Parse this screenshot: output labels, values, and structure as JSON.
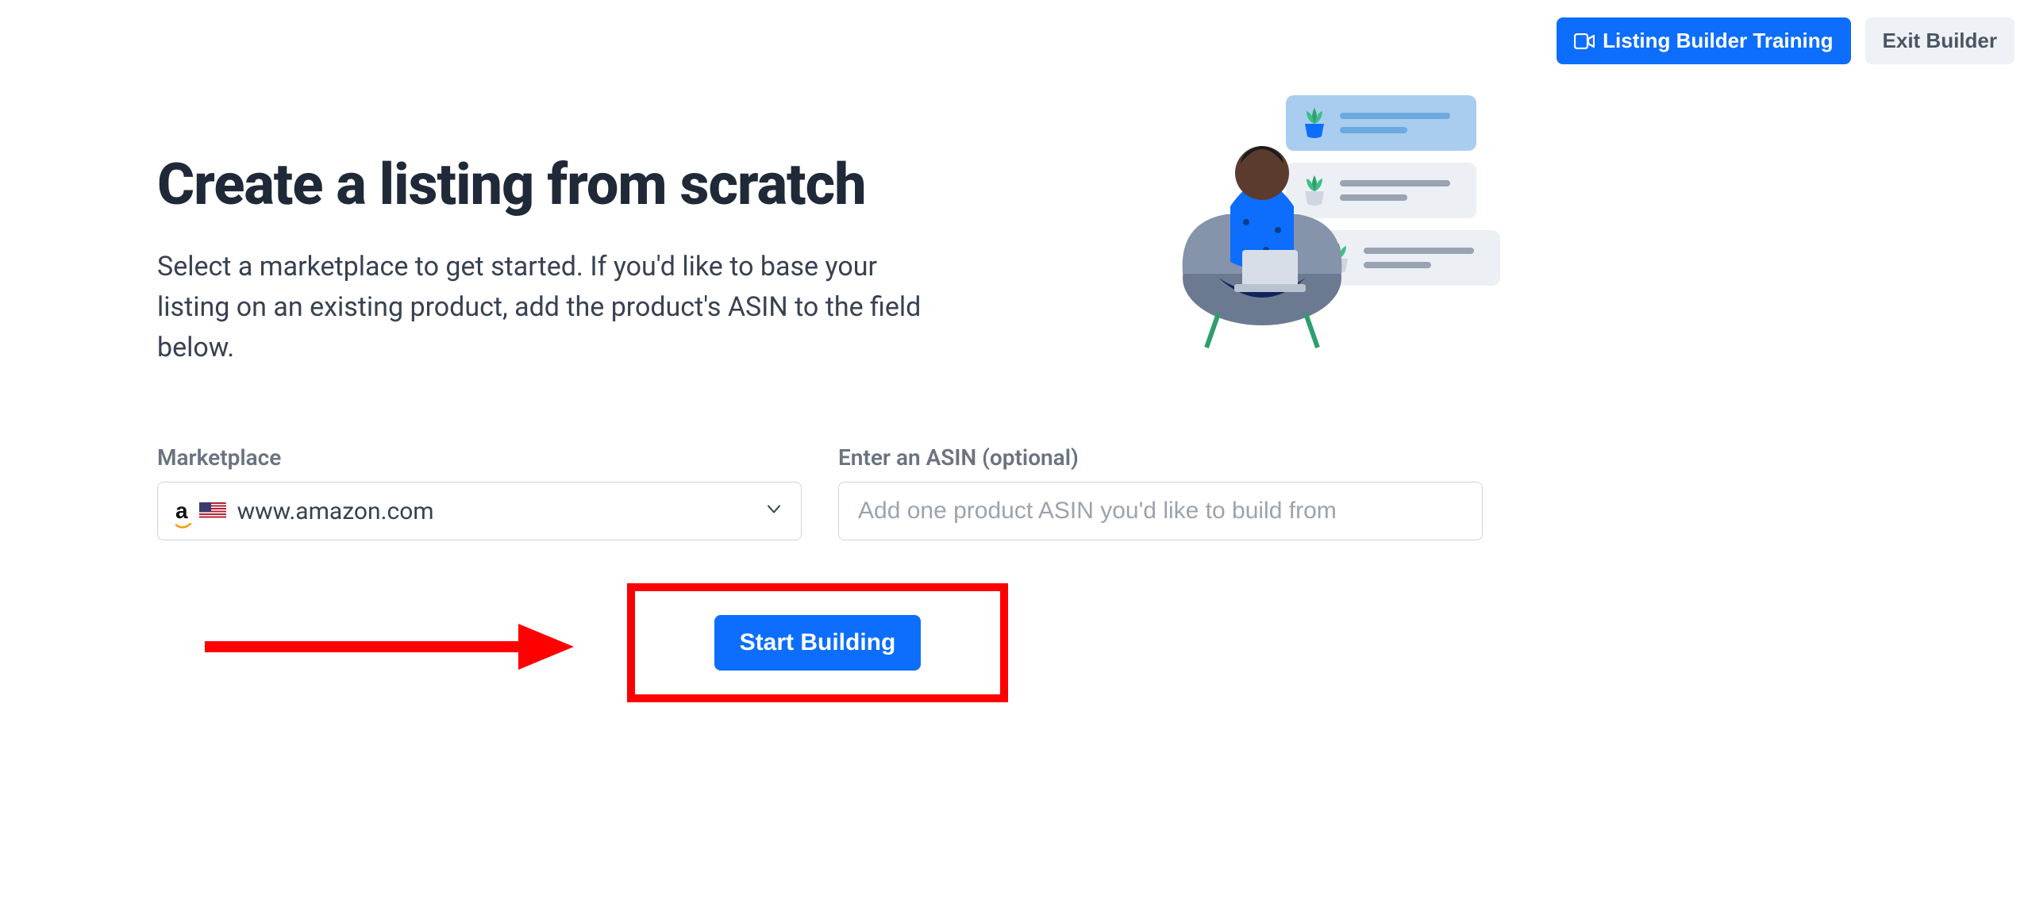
{
  "header": {
    "training_label": "Listing Builder Training",
    "exit_label": "Exit Builder"
  },
  "main": {
    "title": "Create a listing from scratch",
    "description": "Select a marketplace to get started. If you'd like to base your listing on an existing product, add the product's ASIN to the field below."
  },
  "form": {
    "marketplace_label": "Marketplace",
    "marketplace_value": "www.amazon.com",
    "asin_label": "Enter an ASIN (optional)",
    "asin_placeholder": "Add one product ASIN you'd like to build from",
    "asin_value": "",
    "start_label": "Start Building"
  },
  "colors": {
    "primary": "#0d6efd",
    "annotation": "#ff0000"
  }
}
